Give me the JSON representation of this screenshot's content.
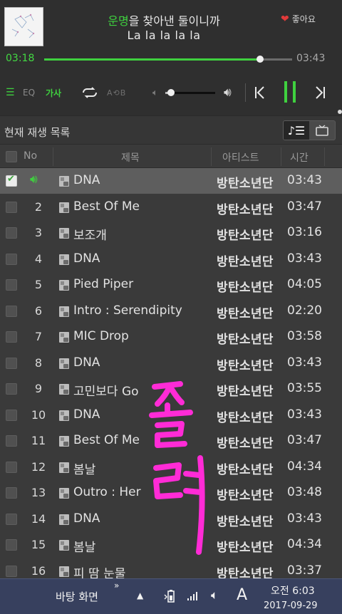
{
  "player": {
    "title_highlight": "운명",
    "title_rest": "을 찾아낸 둘이니까",
    "lyric_line2": "La la la la la",
    "like_label": "좋아요",
    "current_time": "03:18",
    "total_time": "03:43",
    "progress_fraction": 0.87,
    "volume_fraction": 0.12,
    "list_icon": "list-icon",
    "eq_label": "EQ",
    "lyrics_label": "가사",
    "ab_repeat_label": "A⟲B",
    "repeat_icon": "repeat-icon",
    "prev_icon": "previous-icon",
    "pause_icon": "pause-icon",
    "next_icon": "next-icon",
    "accent_color": "#3fd13f"
  },
  "now_playing": {
    "title": "현재 재생 목록",
    "toggle_music_icon": "music-list-icon",
    "toggle_video_icon": "tv-icon"
  },
  "columns": {
    "no": "No",
    "title": "제목",
    "artist": "아티스트",
    "time": "시간"
  },
  "rows": [
    {
      "no": "",
      "title": "DNA",
      "artist": "방탄소년단",
      "time": "03:43",
      "playing": true
    },
    {
      "no": "2",
      "title": "Best Of Me",
      "artist": "방탄소년단",
      "time": "03:47"
    },
    {
      "no": "3",
      "title": "보조개",
      "artist": "방탄소년단",
      "time": "03:16"
    },
    {
      "no": "4",
      "title": "DNA",
      "artist": "방탄소년단",
      "time": "03:43"
    },
    {
      "no": "5",
      "title": "Pied Piper",
      "artist": "방탄소년단",
      "time": "04:05"
    },
    {
      "no": "6",
      "title": "Intro : Serendipity",
      "artist": "방탄소년단",
      "time": "02:20"
    },
    {
      "no": "7",
      "title": "MIC Drop",
      "artist": "방탄소년단",
      "time": "03:58"
    },
    {
      "no": "8",
      "title": "DNA",
      "artist": "방탄소년단",
      "time": "03:43"
    },
    {
      "no": "9",
      "title": "고민보다 Go",
      "artist": "방탄소년단",
      "time": "03:55"
    },
    {
      "no": "10",
      "title": "DNA",
      "artist": "방탄소년단",
      "time": "03:43"
    },
    {
      "no": "11",
      "title": "Best Of Me",
      "artist": "방탄소년단",
      "time": "03:47"
    },
    {
      "no": "12",
      "title": "봄날",
      "artist": "방탄소년단",
      "time": "04:34"
    },
    {
      "no": "13",
      "title": "Outro : Her",
      "artist": "방탄소년단",
      "time": "03:48"
    },
    {
      "no": "14",
      "title": "DNA",
      "artist": "방탄소년단",
      "time": "03:43"
    },
    {
      "no": "15",
      "title": "봄날",
      "artist": "방탄소년단",
      "time": "04:34"
    },
    {
      "no": "16",
      "title": "피 땀 눈물",
      "artist": "방탄소년단",
      "time": "03:37"
    }
  ],
  "annotation": {
    "text": "졸려",
    "color": "#ff2bd6"
  },
  "taskbar": {
    "desktop_label": "바탕 화면",
    "chevron": "»",
    "ime_label": "A",
    "time": "오전 6:03",
    "date": "2017-09-29"
  }
}
